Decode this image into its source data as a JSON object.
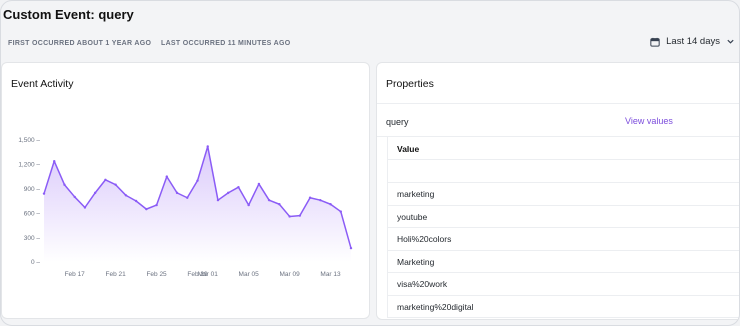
{
  "page": {
    "title": "Custom Event: query",
    "first_occurred": "FIRST OCCURRED ABOUT 1 YEAR AGO",
    "last_occurred": "LAST OCCURRED 11 MINUTES AGO",
    "date_range": "Last 14 days",
    "date_range_icon": "calendar-icon",
    "date_range_chevron": "chevron-down-icon"
  },
  "activity": {
    "title": "Event Activity"
  },
  "properties": {
    "title": "Properties",
    "property_name": "query",
    "view_values_label": "View values",
    "table_header": "Value",
    "values": [
      "marketing",
      "youtube",
      "Holi%20colors",
      "Marketing",
      "visa%20work",
      "marketing%20digital"
    ]
  },
  "colors": {
    "accent": "#7c4ddc",
    "line": "#8b5cf6",
    "area_top": "#d9c8fb",
    "area_bottom": "#ffffff"
  },
  "chart_data": {
    "type": "area",
    "title": "",
    "xlabel": "",
    "ylabel": "",
    "ylim": [
      0,
      1500
    ],
    "yticks": [
      0,
      300,
      600,
      900,
      1200,
      1500
    ],
    "ytick_labels": [
      "0",
      "300",
      "600",
      "900",
      "1,200",
      "1,500"
    ],
    "xtick_labels": [
      "Feb 17",
      "Feb 21",
      "Feb 25",
      "Feb 29",
      "Mar 01",
      "Mar 05",
      "Mar 09",
      "Mar 13"
    ],
    "xtick_index": [
      3,
      7,
      11,
      15,
      16,
      20,
      24,
      28
    ],
    "grid": false,
    "series": [
      {
        "values": [
          840,
          1240,
          950,
          800,
          670,
          850,
          1010,
          950,
          820,
          750,
          650,
          700,
          1050,
          850,
          790,
          1000,
          1420,
          760,
          850,
          920,
          700,
          960,
          760,
          710,
          560,
          570,
          790,
          760,
          710,
          620,
          170
        ]
      }
    ]
  }
}
